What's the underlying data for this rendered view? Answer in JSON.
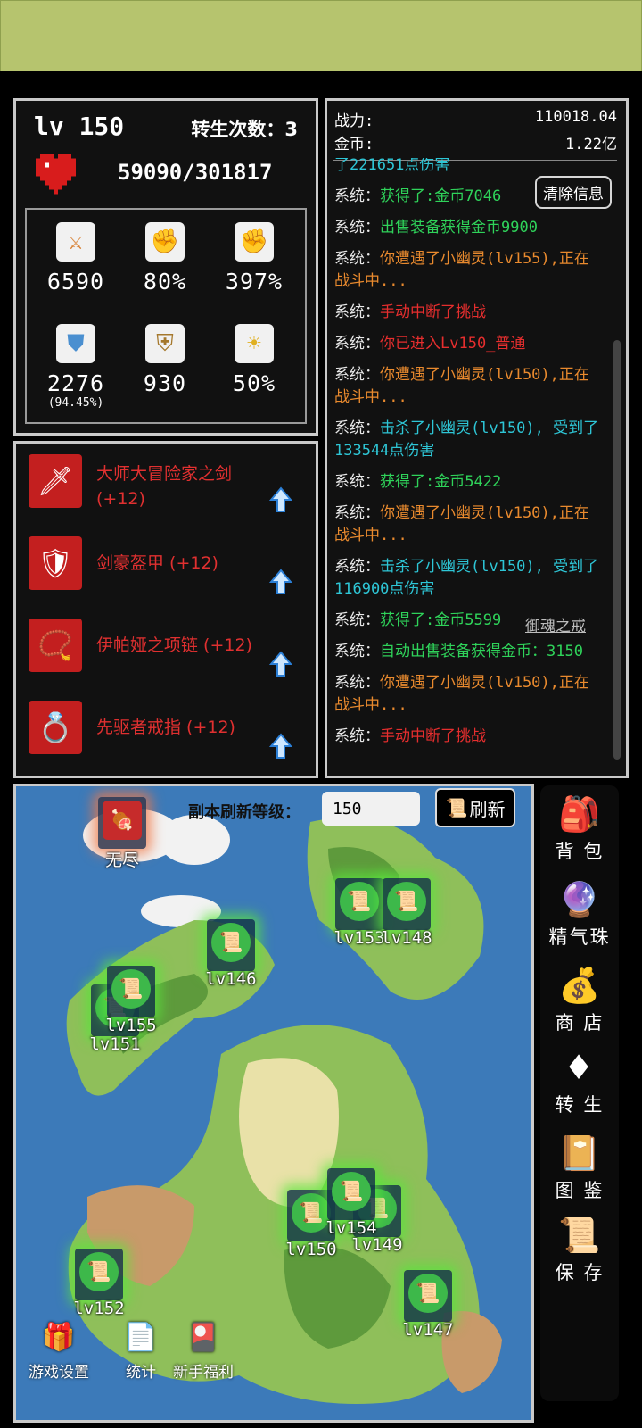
{
  "player": {
    "level": "lv 150",
    "rebirth": "转生次数：3",
    "hp": "59090/301817"
  },
  "stats": [
    {
      "icon": "sword-icon",
      "value": "6590",
      "sub": ""
    },
    {
      "icon": "crit-fist-icon",
      "value": "80%",
      "sub": ""
    },
    {
      "icon": "crit-damage-icon",
      "value": "397%",
      "sub": ""
    },
    {
      "icon": "shield-icon",
      "value": "2276",
      "sub": "(94.45%)"
    },
    {
      "icon": "armor-icon",
      "value": "930",
      "sub": ""
    },
    {
      "icon": "regen-sun-icon",
      "value": "50%",
      "sub": ""
    }
  ],
  "equipment": [
    {
      "name": "大师大冒险家之剑(+12)"
    },
    {
      "name": "剑豪盔甲 (+12)"
    },
    {
      "name": "伊帕娅之项链 (+12)"
    },
    {
      "name": "先驱者戒指 (+12)"
    }
  ],
  "log": {
    "power_label": "战力:",
    "power_value": "110018.04",
    "gold_label": "金币:",
    "gold_value": "1.22亿",
    "clear_button": "清除信息",
    "ring_link": "御魂之戒",
    "partial_top": "了221651点伤害",
    "messages": [
      {
        "sys": "系统：",
        "text": "获得了:金币7046",
        "color": "green"
      },
      {
        "sys": "系统：",
        "text": "出售装备获得金币9900",
        "color": "green"
      },
      {
        "sys": "系统：",
        "text": "你遭遇了小幽灵(lv155),正在战斗中...",
        "color": "orange"
      },
      {
        "sys": "系统：",
        "text": "手动中断了挑战",
        "color": "red"
      },
      {
        "sys": "系统：",
        "text": "你已进入Lv150_普通",
        "color": "red"
      },
      {
        "sys": "系统：",
        "text": "你遭遇了小幽灵(lv150),正在战斗中...",
        "color": "orange"
      },
      {
        "sys": "系统：",
        "text": "击杀了小幽灵(lv150), 受到了133544点伤害",
        "color": "cyan"
      },
      {
        "sys": "系统：",
        "text": "获得了:金币5422",
        "color": "green"
      },
      {
        "sys": "系统：",
        "text": "你遭遇了小幽灵(lv150),正在战斗中...",
        "color": "orange"
      },
      {
        "sys": "系统：",
        "text": "击杀了小幽灵(lv150), 受到了116900点伤害",
        "color": "cyan"
      },
      {
        "sys": "系统：",
        "text": "获得了:金币5599",
        "color": "green"
      },
      {
        "sys": "系统：",
        "text": "自动出售装备获得金币：3150",
        "color": "green"
      },
      {
        "sys": "系统：",
        "text": "你遭遇了小幽灵(lv150),正在战斗中...",
        "color": "orange"
      },
      {
        "sys": "系统：",
        "text": "手动中断了挑战",
        "color": "red"
      }
    ]
  },
  "map": {
    "refresh_label": "副本刷新等级：",
    "refresh_value": "150",
    "refresh_button": "刷新",
    "endless": "无尽",
    "nodes": [
      "lv153",
      "lv148",
      "lv146",
      "lv155",
      "lv151",
      "lv154",
      "lv149",
      "lv150",
      "lv152",
      "lv147"
    ],
    "bottom": [
      "游戏设置",
      "统计",
      "新手福利"
    ]
  },
  "side": [
    "背 包",
    "精气珠",
    "商 店",
    "转 生",
    "图 鉴",
    "保 存"
  ],
  "colors": {
    "topbar": "#b6c46e",
    "accent_red": "#e03030",
    "green": "#2fd35a",
    "orange": "#e98a2e",
    "cyan": "#2ec6d6"
  }
}
